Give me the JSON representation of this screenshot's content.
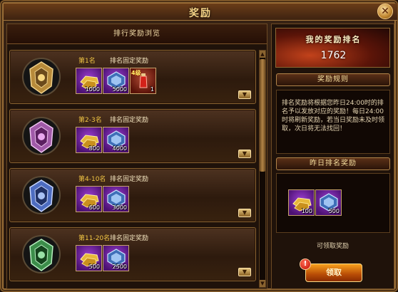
{
  "window": {
    "title": "奖励",
    "close_icon": "close-icon"
  },
  "left_panel": {
    "header": "排行奖励浏览"
  },
  "ranks": [
    {
      "rank": "第1名",
      "label": "排名固定奖励",
      "medal_color": "#b78a3a",
      "medal_icon": "gold-medal-icon",
      "items": [
        {
          "icon": "gold-ingot-icon",
          "count": "1000",
          "badge": ""
        },
        {
          "icon": "blue-gem-icon",
          "count": "5000",
          "badge": ""
        },
        {
          "icon": "red-potion-icon",
          "count": "1",
          "badge": "4级"
        }
      ]
    },
    {
      "rank": "第2-3名",
      "label": "排名固定奖励",
      "medal_color": "#a05aa8",
      "medal_icon": "purple-medal-icon",
      "items": [
        {
          "icon": "gold-ingot-icon",
          "count": "800",
          "badge": ""
        },
        {
          "icon": "blue-gem-icon",
          "count": "4000",
          "badge": ""
        }
      ]
    },
    {
      "rank": "第4-10名",
      "label": "排名固定奖励",
      "medal_color": "#4d6cc0",
      "medal_icon": "blue-medal-icon",
      "items": [
        {
          "icon": "gold-ingot-icon",
          "count": "600",
          "badge": ""
        },
        {
          "icon": "blue-gem-icon",
          "count": "3000",
          "badge": ""
        }
      ]
    },
    {
      "rank": "第11-20名",
      "label": "排名固定奖励",
      "medal_color": "#3c8d4a",
      "medal_icon": "green-medal-icon",
      "items": [
        {
          "icon": "gold-ingot-icon",
          "count": "500",
          "badge": ""
        },
        {
          "icon": "blue-gem-icon",
          "count": "2500",
          "badge": ""
        }
      ]
    }
  ],
  "right_panel": {
    "my_rank_label": "我的奖励排名",
    "my_rank_value": "1762",
    "rules_title": "奖励规则",
    "rules_text": "排名奖励将根据您昨日24:00时的排名予以发放对应的奖励！每日24:00时将刷新奖励，若当日奖励未及时领取，次日将无法找回！",
    "yesterday_title": "昨日排名奖励",
    "yesterday_items": [
      {
        "icon": "gold-ingot-icon",
        "count": "100"
      },
      {
        "icon": "blue-gem-icon",
        "count": "500"
      }
    ],
    "claimable_text": "可领取奖励",
    "claim_button": "领取",
    "claim_alert": "!"
  },
  "colors": {
    "accent": "#f2c644",
    "frame": "#9c7038",
    "item_bg": "#6a1e9a"
  }
}
